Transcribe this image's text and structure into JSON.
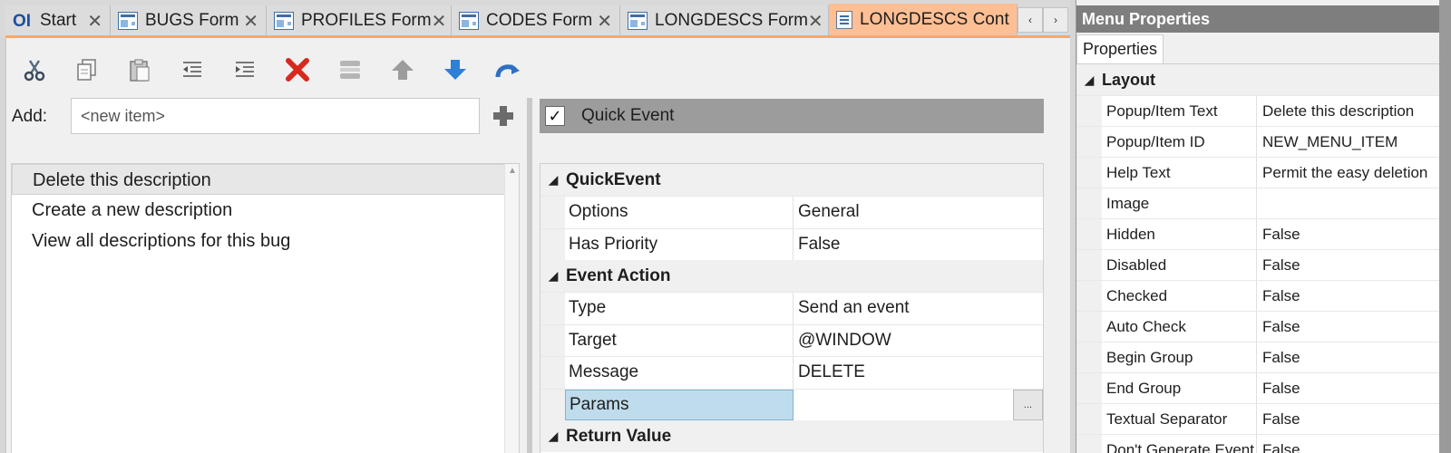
{
  "tabs": [
    {
      "label": "Start",
      "close": "✕"
    },
    {
      "label": "BUGS Form",
      "close": "✕"
    },
    {
      "label": "PROFILES Form",
      "close": "✕"
    },
    {
      "label": "CODES Form",
      "close": "✕"
    },
    {
      "label": "LONGDESCS Form",
      "close": "✕"
    },
    {
      "label": "LONGDESCS Cont"
    }
  ],
  "tab_scroll": {
    "left": "‹",
    "right": "›"
  },
  "start_logo": "OI",
  "colors": {
    "active_tab": "#ffbf94",
    "accent": "#ffa666",
    "delete_red": "#d62a1f",
    "arrow_blue": "#2f7fd6"
  },
  "toolbar": {
    "buttons": [
      "cut-icon",
      "copy-icon",
      "paste-icon",
      "outdent-icon",
      "indent-icon",
      "delete-icon",
      "separator-icon",
      "move-up-icon",
      "move-down-icon",
      "redo-icon"
    ]
  },
  "add": {
    "label": "Add:",
    "placeholder": "<new item>",
    "add_button": "plus-icon"
  },
  "menu_items": [
    "Delete this description",
    "Create a new description",
    "View all descriptions for this bug"
  ],
  "quick_event": {
    "checked": "✓",
    "label": "Quick Event"
  },
  "event_grid": {
    "categories": [
      {
        "title": "QuickEvent",
        "rows": [
          {
            "key": "Options",
            "value": "General"
          },
          {
            "key": "Has Priority",
            "value": "False"
          }
        ]
      },
      {
        "title": "Event Action",
        "rows": [
          {
            "key": "Type",
            "value": "Send an event"
          },
          {
            "key": "Target",
            "value": "@WINDOW"
          },
          {
            "key": "Message",
            "value": "DELETE"
          },
          {
            "key": "Params",
            "value": "",
            "button": "..."
          }
        ]
      },
      {
        "title": "Return Value"
      }
    ]
  },
  "properties": {
    "title": "Menu Properties",
    "tab": "Properties",
    "category": "Layout",
    "rows": [
      {
        "key": "Popup/Item Text",
        "value": "Delete this description"
      },
      {
        "key": "Popup/Item ID",
        "value": "NEW_MENU_ITEM"
      },
      {
        "key": "Help Text",
        "value": "Permit the easy deletion"
      },
      {
        "key": "Image",
        "value": ""
      },
      {
        "key": "Hidden",
        "value": "False"
      },
      {
        "key": "Disabled",
        "value": "False"
      },
      {
        "key": "Checked",
        "value": "False"
      },
      {
        "key": "Auto Check",
        "value": "False"
      },
      {
        "key": "Begin Group",
        "value": "False"
      },
      {
        "key": "End Group",
        "value": "False"
      },
      {
        "key": "Textual Separator",
        "value": "False"
      },
      {
        "key": "Don't Generate Event",
        "value": "False"
      }
    ]
  }
}
